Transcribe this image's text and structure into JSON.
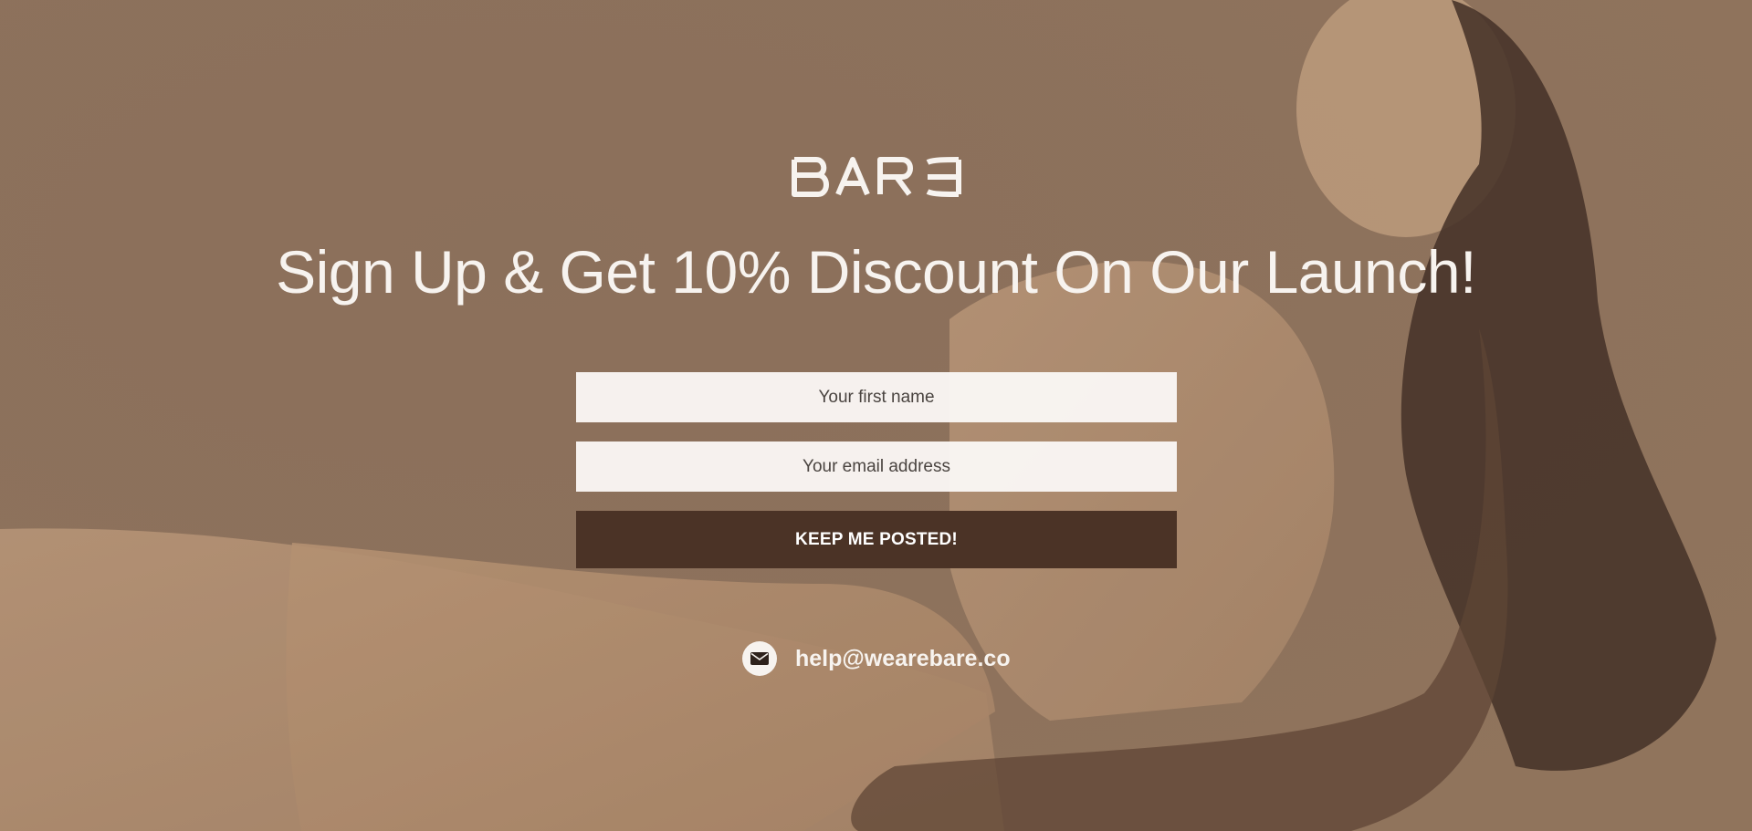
{
  "brand": {
    "logo_text": "BARE"
  },
  "headline": "Sign Up & Get 10% Discount On Our Launch!",
  "form": {
    "first_name_placeholder": "Your first name",
    "email_placeholder": "Your email address",
    "submit_label": "KEEP ME POSTED!"
  },
  "contact": {
    "email": "help@wearebare.co",
    "icon": "envelope-icon"
  },
  "colors": {
    "background": "#92765f",
    "text": "#f7f3ef",
    "button": "#4b3326",
    "input_bg": "#faf7f5"
  }
}
